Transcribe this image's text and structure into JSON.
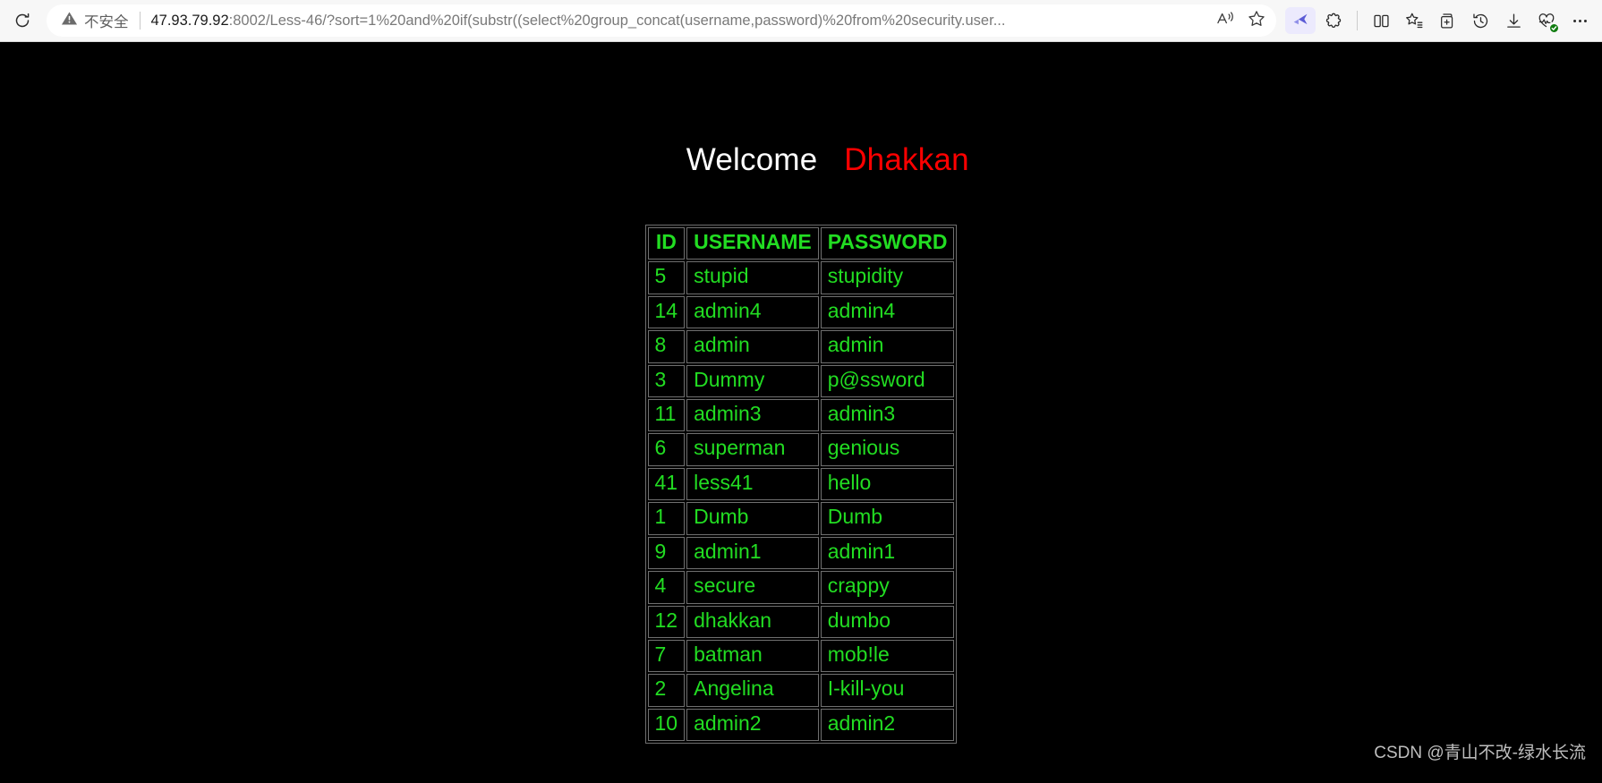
{
  "browser": {
    "reload_label": "reload-icon",
    "security": {
      "label": "不安全",
      "icon": "warning-triangle-icon"
    },
    "url": {
      "host": "47.93.79.92",
      "rest": ":8002/Less-46/?sort=1%20and%20if(substr((select%20group_concat(username,password)%20from%20security.user..."
    },
    "omnibox_actions": [
      {
        "name": "read-aloud-icon",
        "label": "Read aloud"
      },
      {
        "name": "favorite-star-icon",
        "label": "Add to favorites"
      }
    ],
    "toolbar_actions": [
      {
        "name": "copilot-icon",
        "label": "Copilot"
      },
      {
        "name": "extensions-icon",
        "label": "Extensions"
      },
      {
        "name": "split-screen-icon",
        "label": "Split screen"
      },
      {
        "name": "favorites-list-icon",
        "label": "Favorites"
      },
      {
        "name": "collections-icon",
        "label": "Collections"
      },
      {
        "name": "history-icon",
        "label": "History"
      },
      {
        "name": "downloads-icon",
        "label": "Downloads"
      },
      {
        "name": "browser-essentials-icon",
        "label": "Browser essentials"
      },
      {
        "name": "settings-more-icon",
        "label": "Settings and more"
      }
    ]
  },
  "page": {
    "welcome_prefix": "Welcome",
    "welcome_name": "Dhakkan",
    "spacer": "   ",
    "table": {
      "headers": [
        "ID",
        "USERNAME",
        "PASSWORD"
      ],
      "rows": [
        [
          "5",
          "stupid",
          "stupidity"
        ],
        [
          "14",
          "admin4",
          "admin4"
        ],
        [
          "8",
          "admin",
          "admin"
        ],
        [
          "3",
          "Dummy",
          "p@ssword"
        ],
        [
          "11",
          "admin3",
          "admin3"
        ],
        [
          "6",
          "superman",
          "genious"
        ],
        [
          "41",
          "less41",
          "hello"
        ],
        [
          "1",
          "Dumb",
          "Dumb"
        ],
        [
          "9",
          "admin1",
          "admin1"
        ],
        [
          "4",
          "secure",
          "crappy"
        ],
        [
          "12",
          "dhakkan",
          "dumbo"
        ],
        [
          "7",
          "batman",
          "mob!le"
        ],
        [
          "2",
          "Angelina",
          "I-kill-you"
        ],
        [
          "10",
          "admin2",
          "admin2"
        ]
      ]
    },
    "watermark": "CSDN @青山不改-绿水长流"
  },
  "colors": {
    "page_background": "#000000",
    "table_text": "#22dd22",
    "table_border": "#6f6f6f",
    "welcome_text": "#ffffff",
    "welcome_name": "#ff0000",
    "chrome_background": "#f7f7f7"
  }
}
